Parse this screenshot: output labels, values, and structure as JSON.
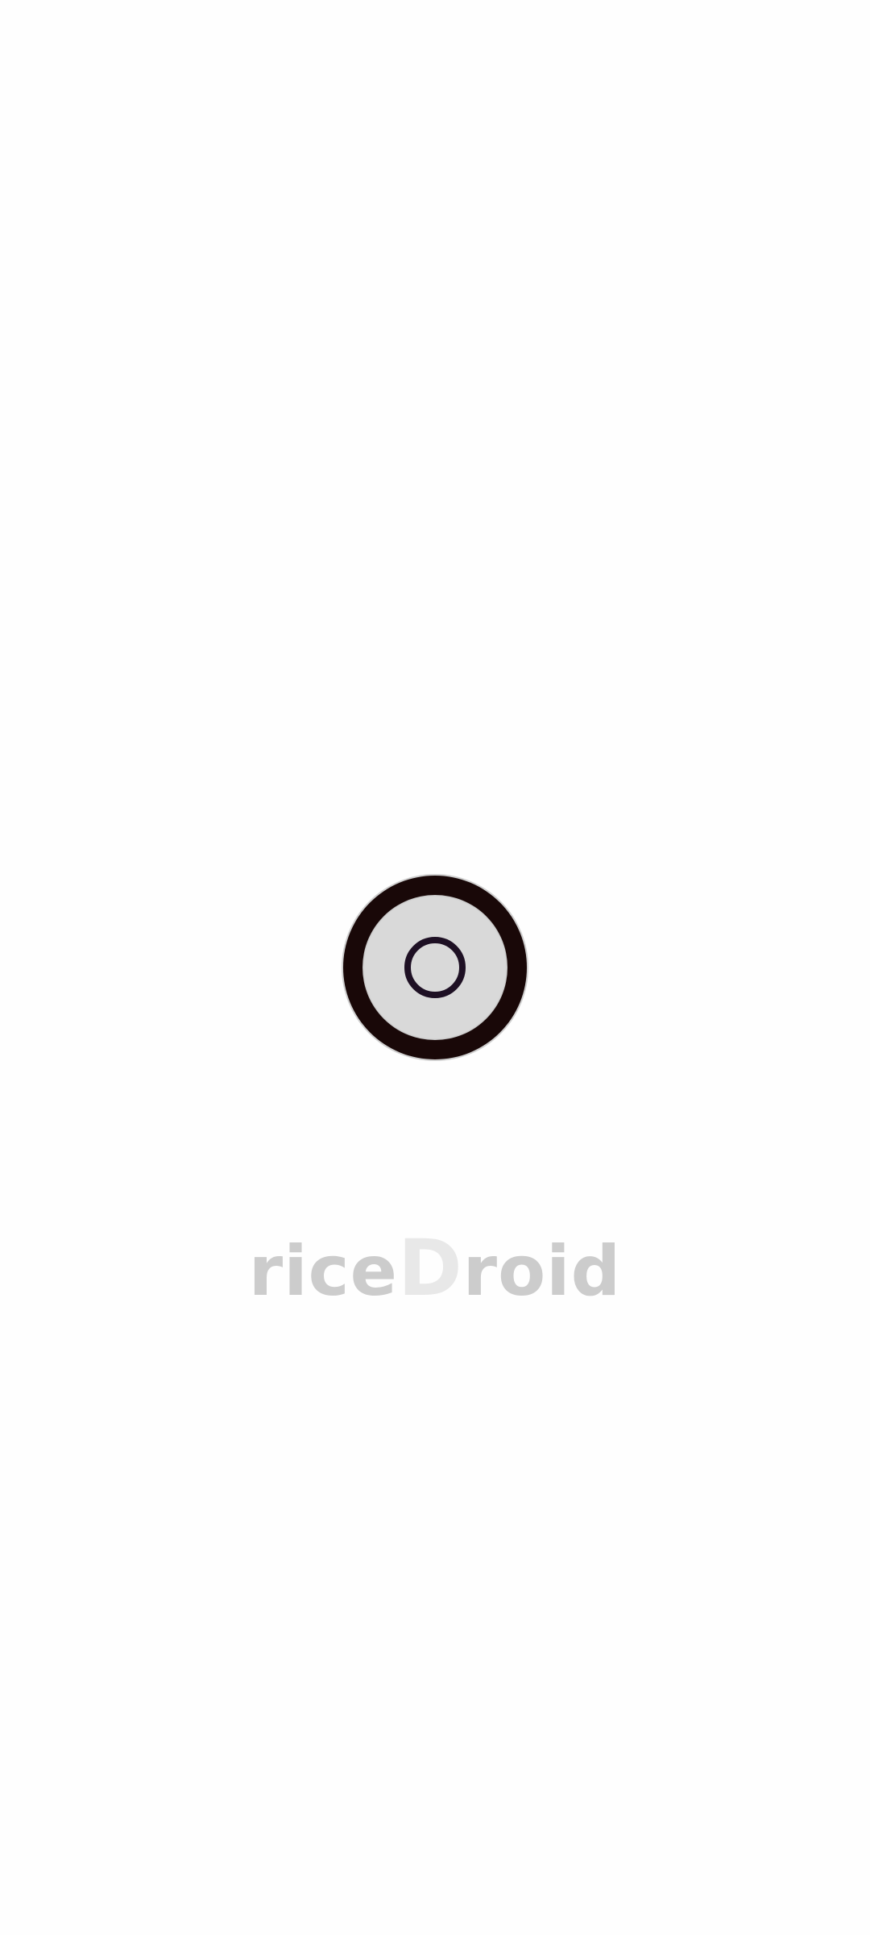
{
  "splash": {
    "brand_prefix": "rice",
    "brand_accent": "D",
    "brand_suffix": "roid"
  },
  "icons": {
    "boot_logo": "boot-ring-logo-icon"
  },
  "colors": {
    "background": "#fefefe",
    "logo_outer": "#190808",
    "logo_inner": "#d9d9d9",
    "logo_ring": "#1e1024",
    "brand_text": "#cccccc",
    "brand_accent": "#e8e8e8"
  }
}
